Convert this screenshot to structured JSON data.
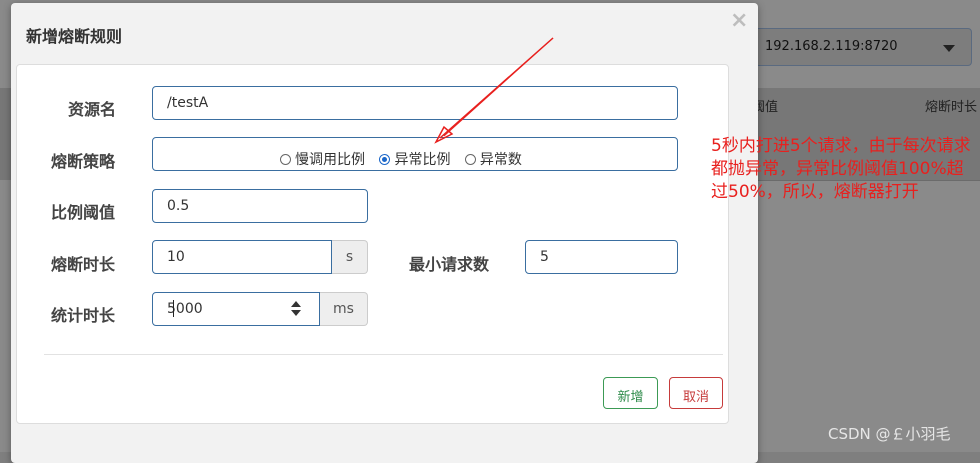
{
  "background": {
    "select_value": "192.168.2.119:8720",
    "col_threshold": "阈值",
    "col_duration": "熔断时长"
  },
  "dialog": {
    "title": "新增熔断规则",
    "close_glyph": "×"
  },
  "form": {
    "resource": {
      "label": "资源名",
      "value": "/testA"
    },
    "strategy": {
      "label": "熔断策略",
      "options": [
        {
          "label": "慢调用比例",
          "selected": false
        },
        {
          "label": "异常比例",
          "selected": true
        },
        {
          "label": "异常数",
          "selected": false
        }
      ]
    },
    "ratio": {
      "label": "比例阈值",
      "value": "0.5"
    },
    "duration": {
      "label": "熔断时长",
      "value": "10",
      "unit": "s"
    },
    "min_requests": {
      "label": "最小请求数",
      "value": "5"
    },
    "stat_duration": {
      "label": "统计时长",
      "value": "5000",
      "unit": "ms"
    }
  },
  "buttons": {
    "add": "新增",
    "cancel": "取消"
  },
  "annotation": "5秒内打进5个请求，由于每次请求都抛异常，异常比例阈值100%超过50%，所以，熔断器打开",
  "watermark": "CSDN @￡小羽毛",
  "colors": {
    "annotation": "#e8201e",
    "add_button": "#2e8b4a",
    "cancel_button": "#c63b3b",
    "focus_border": "#3a6ea0"
  }
}
